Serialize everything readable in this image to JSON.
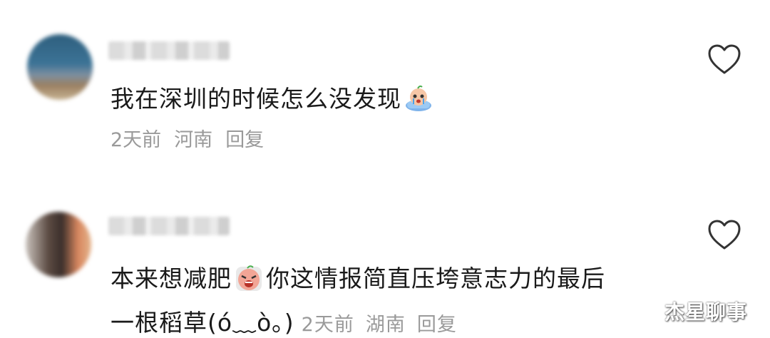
{
  "comments": [
    {
      "text": "我在深圳的时候怎么没发现",
      "emoji": "crying-baby-emoji",
      "time": "2天前",
      "location": "河南",
      "reply": "回复"
    },
    {
      "text_line1_part1": "本来想减肥",
      "emoji": "crying-angry-emoji",
      "text_line1_part2": "你这情报简直压垮意志力的最后",
      "text_line2": "一根稻草(ó﹏ò｡)",
      "time": "2天前",
      "location": "湖南",
      "reply": "回复"
    }
  ],
  "watermark": "杰星聊事",
  "colors": {
    "text": "#1a1a1a",
    "meta": "#9a9a9a",
    "heart": "#333333"
  }
}
